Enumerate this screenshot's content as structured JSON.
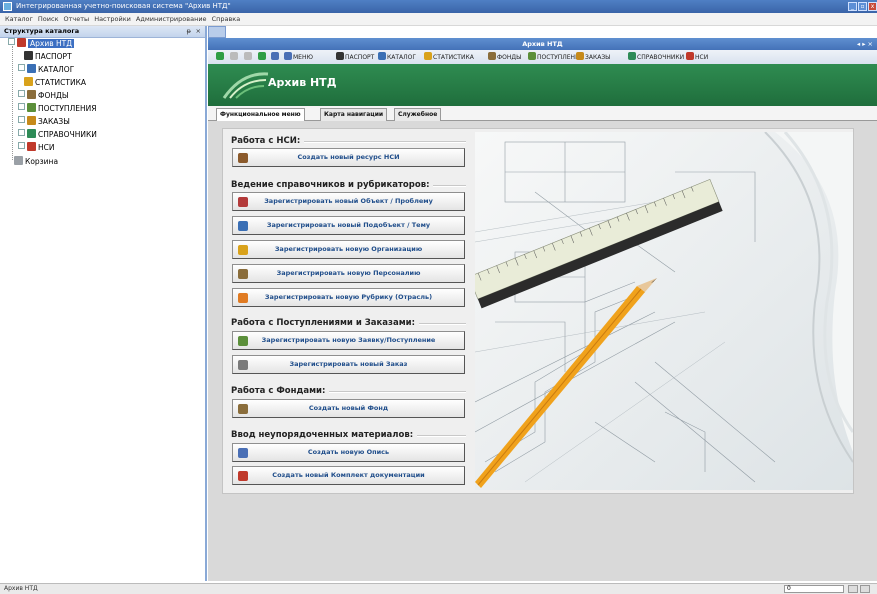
{
  "window": {
    "title": "Интегрированная учетно-поисковая система \"Архив НТД\"",
    "min": "_",
    "max": "▫",
    "close": "x"
  },
  "menu": [
    "Каталог",
    "Поиск",
    "Отчеты",
    "Настройки",
    "Администрирование",
    "Справка"
  ],
  "left_panel": {
    "title": "Структура каталога",
    "pin": "ᵽ",
    "close": "×",
    "tree": [
      {
        "label": "Архив НТД",
        "color": "#c0392b"
      },
      {
        "label": "ПАСПОРТ",
        "color": "#333333"
      },
      {
        "label": "КАТАЛОГ",
        "color": "#3a6fb5"
      },
      {
        "label": "СТАТИСТИКА",
        "color": "#d9a21b"
      },
      {
        "label": "ФОНДЫ",
        "color": "#8a6d3b"
      },
      {
        "label": "ПОСТУПЛЕНИЯ",
        "color": "#5b8f3a"
      },
      {
        "label": "ЗАКАЗЫ",
        "color": "#c68a1a"
      },
      {
        "label": "СПРАВОЧНИКИ",
        "color": "#2e8b57"
      },
      {
        "label": "НСИ",
        "color": "#c0392b"
      },
      {
        "label": "Корзина",
        "color": "#9aa0a6"
      }
    ]
  },
  "document": {
    "title": "Архив НТД",
    "nav_arrows": "◂ ▸ ×"
  },
  "toolbar": {
    "items": [
      {
        "label": "",
        "color": "#2f9e44"
      },
      {
        "label": "",
        "color": "#bbbbbb"
      },
      {
        "label": "",
        "color": "#bbbbbb"
      },
      {
        "label": "",
        "color": "#2f9e44"
      },
      {
        "label": "",
        "color": "#4a6fb5"
      },
      {
        "label": "МЕНЮ",
        "color": "#4a6fb5"
      },
      {
        "label": "ПАСПОРТ",
        "color": "#333333"
      },
      {
        "label": "КАТАЛОГ",
        "color": "#3a6fb5"
      },
      {
        "label": "СТАТИСТИКА",
        "color": "#d9a21b"
      },
      {
        "label": "ФОНДЫ",
        "color": "#8a6d3b"
      },
      {
        "label": "ПОСТУПЛЕНИЯ",
        "color": "#5b8f3a"
      },
      {
        "label": "ЗАКАЗЫ",
        "color": "#c68a1a"
      },
      {
        "label": "СПРАВОЧНИКИ",
        "color": "#2e8b57"
      },
      {
        "label": "НСИ",
        "color": "#c0392b"
      }
    ]
  },
  "header": {
    "title": "Архив НТД",
    "color": "#2a7f47"
  },
  "tabs": [
    "Функциональное меню",
    "Карта навигации",
    "Служебное"
  ],
  "sections": [
    {
      "title": "Работа с НСИ:",
      "buttons": [
        {
          "label": "Создать новый ресурс НСИ",
          "color": "#8b5a2b"
        }
      ]
    },
    {
      "title": "Ведение справочников и рубрикаторов:",
      "buttons": [
        {
          "label": "Зарегистрировать новый Объект / Проблему",
          "color": "#b33a3a"
        },
        {
          "label": "Зарегистрировать новый Подобъект / Тему",
          "color": "#3a6fb5"
        },
        {
          "label": "Зарегистрировать новую Организацию",
          "color": "#d9a21b"
        },
        {
          "label": "Зарегистрировать новую Персоналию",
          "color": "#8a6d3b"
        },
        {
          "label": "Зарегистрировать новую Рубрику (Отрасль)",
          "color": "#e07b22"
        }
      ]
    },
    {
      "title": "Работа с Поступлениями и Заказами:",
      "buttons": [
        {
          "label": "Зарегистрировать новую Заявку/Поступление",
          "color": "#5b8f3a"
        },
        {
          "label": "Зарегистрировать новый Заказ",
          "color": "#7a7a7a"
        }
      ]
    },
    {
      "title": "Работа с Фондами:",
      "buttons": [
        {
          "label": "Создать новый Фонд",
          "color": "#8a6d3b"
        }
      ]
    },
    {
      "title": "Ввод неупорядоченных материалов:",
      "buttons": [
        {
          "label": "Создать новую Опись",
          "color": "#4a6fb5"
        },
        {
          "label": "Создать новый Комплект документации",
          "color": "#c0392b"
        }
      ]
    }
  ],
  "status": {
    "text": "Архив НТД",
    "field": "0"
  }
}
